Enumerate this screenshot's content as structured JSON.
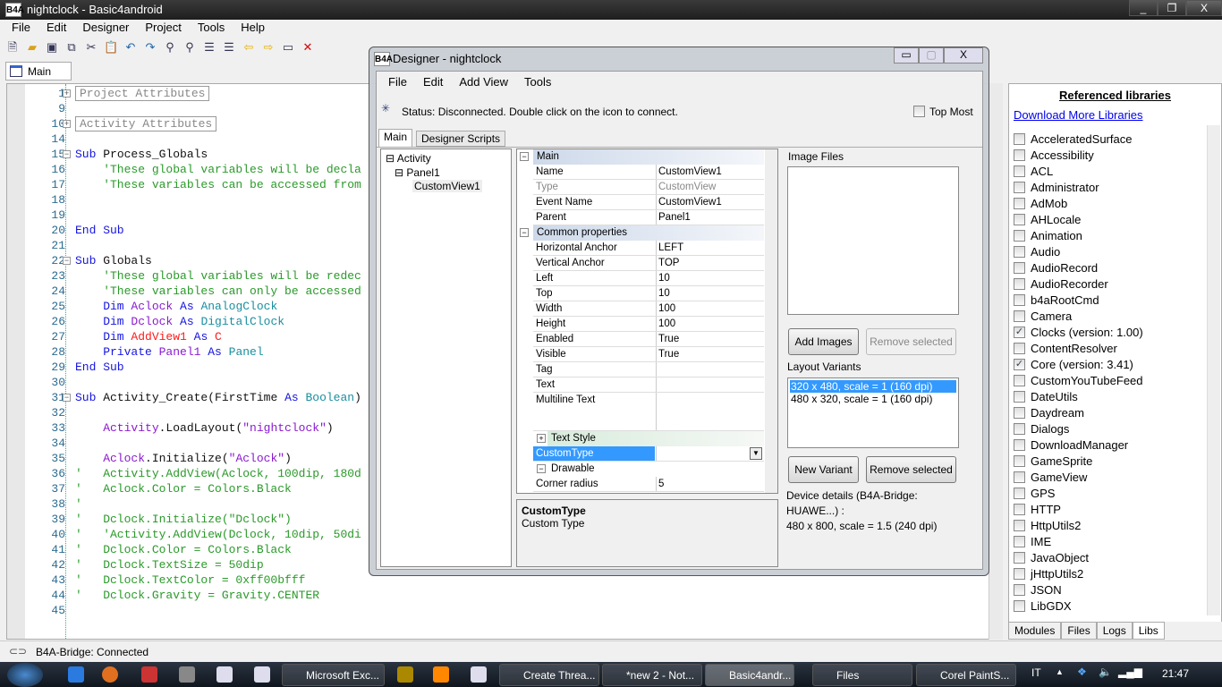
{
  "app": {
    "title": "nightclock - Basic4android",
    "logo": "B4A",
    "window_controls": [
      "minimize",
      "restore",
      "close"
    ]
  },
  "menu": [
    "File",
    "Edit",
    "Designer",
    "Project",
    "Tools",
    "Help"
  ],
  "toolbar_icons": [
    "new-file-icon",
    "open-folder-icon",
    "save-icon",
    "copy-icon",
    "cut-icon",
    "paste-icon",
    "undo-icon",
    "redo-icon",
    "find-icon",
    "find-replace-icon",
    "comment-icon",
    "uncomment-icon",
    "back-arrow-icon",
    "forward-arrow-icon",
    "designer-icon",
    "remove-icon"
  ],
  "editor": {
    "tab": "Main",
    "lines": [
      {
        "n": "1",
        "fold": "+",
        "seg": [
          {
            "t": "Project Attributes",
            "c": "rg"
          }
        ]
      },
      {
        "n": "9",
        "seg": []
      },
      {
        "n": "10",
        "fold": "+",
        "seg": [
          {
            "t": "Activity Attributes",
            "c": "rg"
          }
        ]
      },
      {
        "n": "14",
        "seg": []
      },
      {
        "n": "15",
        "fold": "-",
        "seg": [
          {
            "t": "Sub ",
            "c": "kw"
          },
          {
            "t": "Process_Globals",
            "c": "pl"
          }
        ]
      },
      {
        "n": "16",
        "seg": [
          {
            "t": "    'These global variables will be decla",
            "c": "cm"
          }
        ]
      },
      {
        "n": "17",
        "seg": [
          {
            "t": "    'These variables can be accessed from",
            "c": "cm"
          }
        ]
      },
      {
        "n": "18",
        "seg": []
      },
      {
        "n": "19",
        "seg": []
      },
      {
        "n": "20",
        "seg": [
          {
            "t": "End Sub",
            "c": "kw"
          }
        ]
      },
      {
        "n": "21",
        "seg": []
      },
      {
        "n": "22",
        "fold": "-",
        "seg": [
          {
            "t": "Sub ",
            "c": "kw"
          },
          {
            "t": "Globals",
            "c": "pl"
          }
        ]
      },
      {
        "n": "23",
        "seg": [
          {
            "t": "    'These global variables will be redec",
            "c": "cm"
          }
        ]
      },
      {
        "n": "24",
        "seg": [
          {
            "t": "    'These variables can only be accessed",
            "c": "cm"
          }
        ]
      },
      {
        "n": "25",
        "seg": [
          {
            "t": "    Dim ",
            "c": "kw"
          },
          {
            "t": "Aclock ",
            "c": "id"
          },
          {
            "t": "As ",
            "c": "kw"
          },
          {
            "t": "AnalogClock",
            "c": "ty"
          }
        ]
      },
      {
        "n": "26",
        "seg": [
          {
            "t": "    Dim ",
            "c": "kw"
          },
          {
            "t": "Dclock ",
            "c": "id"
          },
          {
            "t": "As ",
            "c": "kw"
          },
          {
            "t": "DigitalClock",
            "c": "ty"
          }
        ]
      },
      {
        "n": "27",
        "seg": [
          {
            "t": "    Dim ",
            "c": "kw"
          },
          {
            "t": "AddView1 ",
            "c": "rd"
          },
          {
            "t": "As ",
            "c": "kw"
          },
          {
            "t": "C",
            "c": "rd"
          }
        ]
      },
      {
        "n": "28",
        "seg": [
          {
            "t": "    Private ",
            "c": "kw"
          },
          {
            "t": "Panel1 ",
            "c": "id"
          },
          {
            "t": "As ",
            "c": "kw"
          },
          {
            "t": "Panel",
            "c": "ty"
          }
        ]
      },
      {
        "n": "29",
        "seg": [
          {
            "t": "End Sub",
            "c": "kw"
          }
        ]
      },
      {
        "n": "30",
        "seg": []
      },
      {
        "n": "31",
        "fold": "-",
        "seg": [
          {
            "t": "Sub ",
            "c": "kw"
          },
          {
            "t": "Activity_Create(FirstTime ",
            "c": "pl"
          },
          {
            "t": "As ",
            "c": "kw"
          },
          {
            "t": "Boolean",
            "c": "ty"
          },
          {
            "t": ")",
            "c": "pl"
          }
        ]
      },
      {
        "n": "32",
        "seg": []
      },
      {
        "n": "33",
        "seg": [
          {
            "t": "    Activity",
            "c": "id"
          },
          {
            "t": ".LoadLayout(",
            "c": "pl"
          },
          {
            "t": "\"nightclock\"",
            "c": "st"
          },
          {
            "t": ")",
            "c": "pl"
          }
        ]
      },
      {
        "n": "34",
        "seg": []
      },
      {
        "n": "35",
        "seg": [
          {
            "t": "    Aclock",
            "c": "id"
          },
          {
            "t": ".Initialize(",
            "c": "pl"
          },
          {
            "t": "\"Aclock\"",
            "c": "st"
          },
          {
            "t": ")",
            "c": "pl"
          }
        ]
      },
      {
        "n": "36",
        "seg": [
          {
            "t": "'   Activity.AddView(Aclock, 100dip, 180d",
            "c": "cm"
          }
        ]
      },
      {
        "n": "37",
        "seg": [
          {
            "t": "'   Aclock.Color = Colors.Black",
            "c": "cm"
          }
        ]
      },
      {
        "n": "38",
        "seg": [
          {
            "t": "'",
            "c": "cm"
          }
        ]
      },
      {
        "n": "39",
        "seg": [
          {
            "t": "'   Dclock.Initialize(\"Dclock\")",
            "c": "cm"
          }
        ]
      },
      {
        "n": "40",
        "seg": [
          {
            "t": "'   'Activity.AddView(Dclock, 10dip, 50di",
            "c": "cm"
          }
        ]
      },
      {
        "n": "41",
        "seg": [
          {
            "t": "'   Dclock.Color = Colors.Black",
            "c": "cm"
          }
        ]
      },
      {
        "n": "42",
        "seg": [
          {
            "t": "'   Dclock.TextSize = 50dip",
            "c": "cm"
          }
        ]
      },
      {
        "n": "43",
        "seg": [
          {
            "t": "'   Dclock.TextColor = 0xff00bfff",
            "c": "cm"
          }
        ]
      },
      {
        "n": "44",
        "seg": [
          {
            "t": "'   Dclock.Gravity = Gravity.CENTER",
            "c": "cm"
          }
        ]
      },
      {
        "n": "45",
        "seg": []
      }
    ]
  },
  "libraries": {
    "title": "Referenced libraries",
    "download_link": "Download More Libraries",
    "items": [
      {
        "name": "AcceleratedSurface",
        "checked": false
      },
      {
        "name": "Accessibility",
        "checked": false
      },
      {
        "name": "ACL",
        "checked": false
      },
      {
        "name": "Administrator",
        "checked": false
      },
      {
        "name": "AdMob",
        "checked": false
      },
      {
        "name": "AHLocale",
        "checked": false
      },
      {
        "name": "Animation",
        "checked": false
      },
      {
        "name": "Audio",
        "checked": false
      },
      {
        "name": "AudioRecord",
        "checked": false
      },
      {
        "name": "AudioRecorder",
        "checked": false
      },
      {
        "name": "b4aRootCmd",
        "checked": false
      },
      {
        "name": "Camera",
        "checked": false
      },
      {
        "name": "Clocks (version: 1.00)",
        "checked": true
      },
      {
        "name": "ContentResolver",
        "checked": false
      },
      {
        "name": "Core (version: 3.41)",
        "checked": true
      },
      {
        "name": "CustomYouTubeFeed",
        "checked": false
      },
      {
        "name": "DateUtils",
        "checked": false
      },
      {
        "name": "Daydream",
        "checked": false
      },
      {
        "name": "Dialogs",
        "checked": false
      },
      {
        "name": "DownloadManager",
        "checked": false
      },
      {
        "name": "GameSprite",
        "checked": false
      },
      {
        "name": "GameView",
        "checked": false
      },
      {
        "name": "GPS",
        "checked": false
      },
      {
        "name": "HTTP",
        "checked": false
      },
      {
        "name": "HttpUtils2",
        "checked": false
      },
      {
        "name": "IME",
        "checked": false
      },
      {
        "name": "JavaObject",
        "checked": false
      },
      {
        "name": "jHttpUtils2",
        "checked": false
      },
      {
        "name": "JSON",
        "checked": false
      },
      {
        "name": "LibGDX",
        "checked": false
      }
    ],
    "tabs": [
      "Modules",
      "Files",
      "Logs",
      "Libs"
    ]
  },
  "status": {
    "text": "B4A-Bridge: Connected"
  },
  "designer": {
    "title": "Designer - nightclock",
    "menu": [
      "File",
      "Edit",
      "Add View",
      "Tools"
    ],
    "status": "Status: Disconnected. Double click on the icon to connect.",
    "top_most": "Top Most",
    "tabs": [
      "Main",
      "Designer Scripts"
    ],
    "tree": [
      "Activity",
      "Panel1",
      "CustomView1"
    ],
    "props": [
      {
        "cat": "Main"
      },
      {
        "k": "Name",
        "v": "CustomView1"
      },
      {
        "k": "Type",
        "v": "CustomView",
        "dim": true
      },
      {
        "k": "Event Name",
        "v": "CustomView1"
      },
      {
        "k": "Parent",
        "v": "Panel1"
      },
      {
        "cat": "Common properties"
      },
      {
        "k": "Horizontal Anchor",
        "v": "LEFT"
      },
      {
        "k": "Vertical Anchor",
        "v": "TOP"
      },
      {
        "k": "Left",
        "v": "10"
      },
      {
        "k": "Top",
        "v": "10"
      },
      {
        "k": "Width",
        "v": "100"
      },
      {
        "k": "Height",
        "v": "100"
      },
      {
        "k": "Enabled",
        "v": "True"
      },
      {
        "k": "Visible",
        "v": "True"
      },
      {
        "k": "Tag",
        "v": ""
      },
      {
        "k": "Text",
        "v": ""
      },
      {
        "k": "Multiline Text",
        "v": "",
        "tall": true
      },
      {
        "cat": "Text Style",
        "collapsed": true
      },
      {
        "k": "CustomType",
        "v": "",
        "sel": true
      },
      {
        "cat": "Drawable"
      },
      {
        "k": "Corner radius",
        "v": "5"
      }
    ],
    "desc_title": "CustomType",
    "desc_text": "Custom Type",
    "image_files_label": "Image Files",
    "add_images": "Add Images",
    "remove_selected": "Remove selected",
    "layout_variants_label": "Layout Variants",
    "variants": [
      "320 x 480, scale = 1 (160 dpi)",
      "480 x 320, scale = 1 (160 dpi)"
    ],
    "new_variant": "New Variant",
    "device_details": [
      "Device details (B4A-Bridge:",
      "HUAWE...) :",
      "480 x 800, scale = 1.5 (240 dpi)"
    ]
  },
  "taskbar": {
    "tasks": [
      "Microsoft Exc...",
      "Create Threa...",
      "*new  2 - Not...",
      "Basic4andr...",
      "Files",
      "Corel PaintS..."
    ],
    "lang": "IT",
    "clock": "21:47"
  }
}
